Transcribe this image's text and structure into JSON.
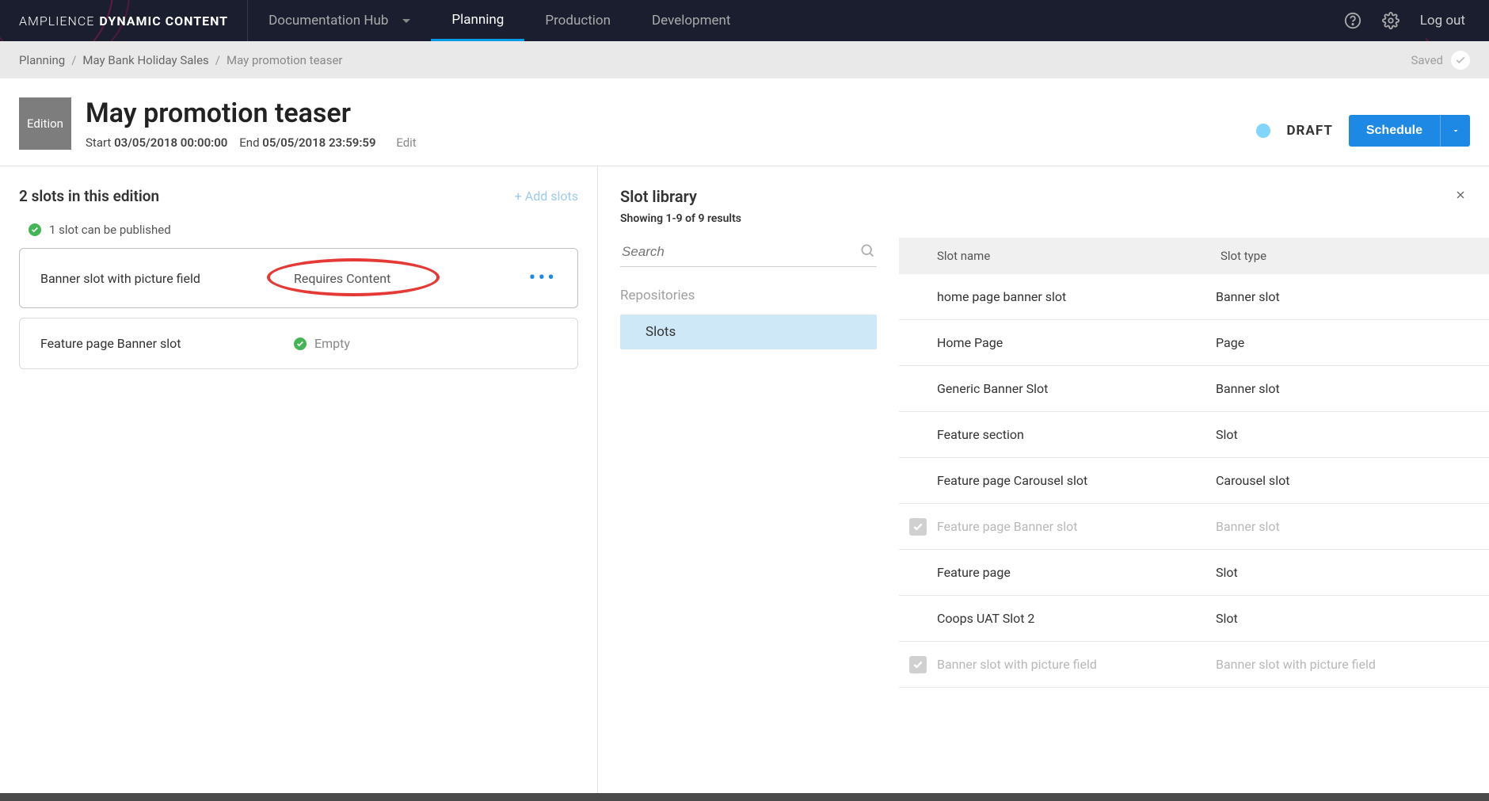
{
  "brand": {
    "a": "AMPLIENCE",
    "b": "DYNAMIC CONTENT"
  },
  "nav": {
    "doc_hub": "Documentation Hub",
    "planning": "Planning",
    "production": "Production",
    "development": "Development",
    "logout": "Log out"
  },
  "breadcrumb": {
    "a": "Planning",
    "b": "May Bank Holiday Sales",
    "c": "May promotion teaser",
    "saved": "Saved"
  },
  "edition_chip": "Edition",
  "title": "May promotion teaser",
  "times": {
    "start_lbl": "Start",
    "start_val": "03/05/2018 00:00:00",
    "end_lbl": "End",
    "end_val": "05/05/2018 23:59:59",
    "edit": "Edit"
  },
  "status": {
    "label": "DRAFT"
  },
  "schedule_btn": "Schedule",
  "left": {
    "heading": "2 slots in this edition",
    "add": "+ Add slots",
    "publish_note": "1 slot can be published",
    "slots": [
      {
        "name": "Banner slot with picture field",
        "status": "Requires Content",
        "kind": "requires"
      },
      {
        "name": "Feature page Banner slot",
        "status": "Empty",
        "kind": "empty"
      }
    ]
  },
  "lib": {
    "title": "Slot library",
    "sub": "Showing 1-9 of 9 results",
    "search_placeholder": "Search",
    "repos_label": "Repositories",
    "repo_item": "Slots",
    "th_name": "Slot name",
    "th_type": "Slot type",
    "rows": [
      {
        "name": "home page banner slot",
        "type": "Banner slot",
        "checked": false,
        "muted": false
      },
      {
        "name": "Home Page",
        "type": "Page",
        "checked": false,
        "muted": false
      },
      {
        "name": "Generic Banner Slot",
        "type": "Banner slot",
        "checked": false,
        "muted": false
      },
      {
        "name": "Feature section",
        "type": "Slot",
        "checked": false,
        "muted": false
      },
      {
        "name": "Feature page Carousel slot",
        "type": "Carousel slot",
        "checked": false,
        "muted": false
      },
      {
        "name": "Feature page Banner slot",
        "type": "Banner slot",
        "checked": true,
        "muted": true
      },
      {
        "name": "Feature page",
        "type": "Slot",
        "checked": false,
        "muted": false
      },
      {
        "name": "Coops UAT Slot 2",
        "type": "Slot",
        "checked": false,
        "muted": false
      },
      {
        "name": "Banner slot with picture field",
        "type": "Banner slot with picture field",
        "checked": true,
        "muted": true
      }
    ]
  }
}
